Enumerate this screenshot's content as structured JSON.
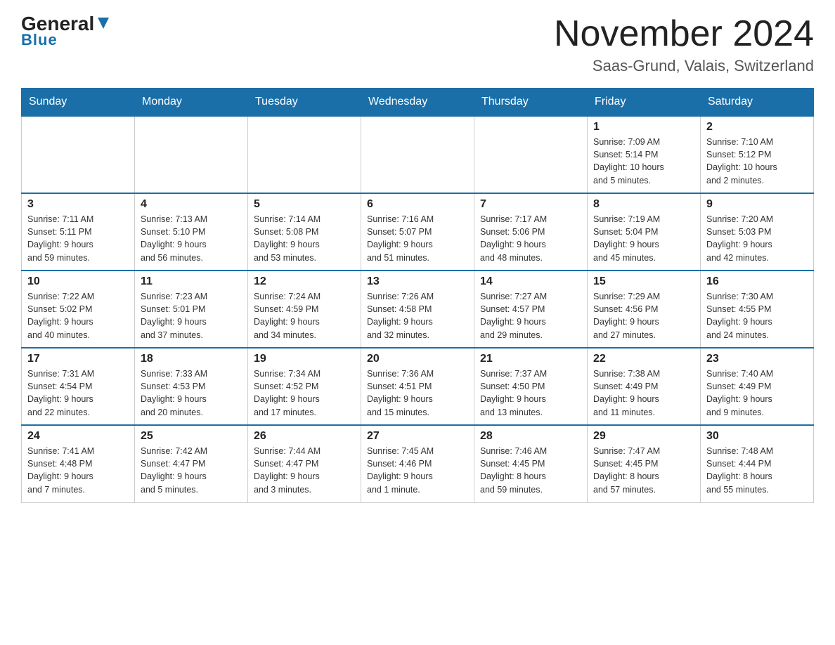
{
  "header": {
    "logo_general": "General",
    "logo_blue": "Blue",
    "month_title": "November 2024",
    "location": "Saas-Grund, Valais, Switzerland"
  },
  "weekdays": [
    "Sunday",
    "Monday",
    "Tuesday",
    "Wednesday",
    "Thursday",
    "Friday",
    "Saturday"
  ],
  "weeks": [
    [
      {
        "day": "",
        "info": ""
      },
      {
        "day": "",
        "info": ""
      },
      {
        "day": "",
        "info": ""
      },
      {
        "day": "",
        "info": ""
      },
      {
        "day": "",
        "info": ""
      },
      {
        "day": "1",
        "info": "Sunrise: 7:09 AM\nSunset: 5:14 PM\nDaylight: 10 hours\nand 5 minutes."
      },
      {
        "day": "2",
        "info": "Sunrise: 7:10 AM\nSunset: 5:12 PM\nDaylight: 10 hours\nand 2 minutes."
      }
    ],
    [
      {
        "day": "3",
        "info": "Sunrise: 7:11 AM\nSunset: 5:11 PM\nDaylight: 9 hours\nand 59 minutes."
      },
      {
        "day": "4",
        "info": "Sunrise: 7:13 AM\nSunset: 5:10 PM\nDaylight: 9 hours\nand 56 minutes."
      },
      {
        "day": "5",
        "info": "Sunrise: 7:14 AM\nSunset: 5:08 PM\nDaylight: 9 hours\nand 53 minutes."
      },
      {
        "day": "6",
        "info": "Sunrise: 7:16 AM\nSunset: 5:07 PM\nDaylight: 9 hours\nand 51 minutes."
      },
      {
        "day": "7",
        "info": "Sunrise: 7:17 AM\nSunset: 5:06 PM\nDaylight: 9 hours\nand 48 minutes."
      },
      {
        "day": "8",
        "info": "Sunrise: 7:19 AM\nSunset: 5:04 PM\nDaylight: 9 hours\nand 45 minutes."
      },
      {
        "day": "9",
        "info": "Sunrise: 7:20 AM\nSunset: 5:03 PM\nDaylight: 9 hours\nand 42 minutes."
      }
    ],
    [
      {
        "day": "10",
        "info": "Sunrise: 7:22 AM\nSunset: 5:02 PM\nDaylight: 9 hours\nand 40 minutes."
      },
      {
        "day": "11",
        "info": "Sunrise: 7:23 AM\nSunset: 5:01 PM\nDaylight: 9 hours\nand 37 minutes."
      },
      {
        "day": "12",
        "info": "Sunrise: 7:24 AM\nSunset: 4:59 PM\nDaylight: 9 hours\nand 34 minutes."
      },
      {
        "day": "13",
        "info": "Sunrise: 7:26 AM\nSunset: 4:58 PM\nDaylight: 9 hours\nand 32 minutes."
      },
      {
        "day": "14",
        "info": "Sunrise: 7:27 AM\nSunset: 4:57 PM\nDaylight: 9 hours\nand 29 minutes."
      },
      {
        "day": "15",
        "info": "Sunrise: 7:29 AM\nSunset: 4:56 PM\nDaylight: 9 hours\nand 27 minutes."
      },
      {
        "day": "16",
        "info": "Sunrise: 7:30 AM\nSunset: 4:55 PM\nDaylight: 9 hours\nand 24 minutes."
      }
    ],
    [
      {
        "day": "17",
        "info": "Sunrise: 7:31 AM\nSunset: 4:54 PM\nDaylight: 9 hours\nand 22 minutes."
      },
      {
        "day": "18",
        "info": "Sunrise: 7:33 AM\nSunset: 4:53 PM\nDaylight: 9 hours\nand 20 minutes."
      },
      {
        "day": "19",
        "info": "Sunrise: 7:34 AM\nSunset: 4:52 PM\nDaylight: 9 hours\nand 17 minutes."
      },
      {
        "day": "20",
        "info": "Sunrise: 7:36 AM\nSunset: 4:51 PM\nDaylight: 9 hours\nand 15 minutes."
      },
      {
        "day": "21",
        "info": "Sunrise: 7:37 AM\nSunset: 4:50 PM\nDaylight: 9 hours\nand 13 minutes."
      },
      {
        "day": "22",
        "info": "Sunrise: 7:38 AM\nSunset: 4:49 PM\nDaylight: 9 hours\nand 11 minutes."
      },
      {
        "day": "23",
        "info": "Sunrise: 7:40 AM\nSunset: 4:49 PM\nDaylight: 9 hours\nand 9 minutes."
      }
    ],
    [
      {
        "day": "24",
        "info": "Sunrise: 7:41 AM\nSunset: 4:48 PM\nDaylight: 9 hours\nand 7 minutes."
      },
      {
        "day": "25",
        "info": "Sunrise: 7:42 AM\nSunset: 4:47 PM\nDaylight: 9 hours\nand 5 minutes."
      },
      {
        "day": "26",
        "info": "Sunrise: 7:44 AM\nSunset: 4:47 PM\nDaylight: 9 hours\nand 3 minutes."
      },
      {
        "day": "27",
        "info": "Sunrise: 7:45 AM\nSunset: 4:46 PM\nDaylight: 9 hours\nand 1 minute."
      },
      {
        "day": "28",
        "info": "Sunrise: 7:46 AM\nSunset: 4:45 PM\nDaylight: 8 hours\nand 59 minutes."
      },
      {
        "day": "29",
        "info": "Sunrise: 7:47 AM\nSunset: 4:45 PM\nDaylight: 8 hours\nand 57 minutes."
      },
      {
        "day": "30",
        "info": "Sunrise: 7:48 AM\nSunset: 4:44 PM\nDaylight: 8 hours\nand 55 minutes."
      }
    ]
  ]
}
